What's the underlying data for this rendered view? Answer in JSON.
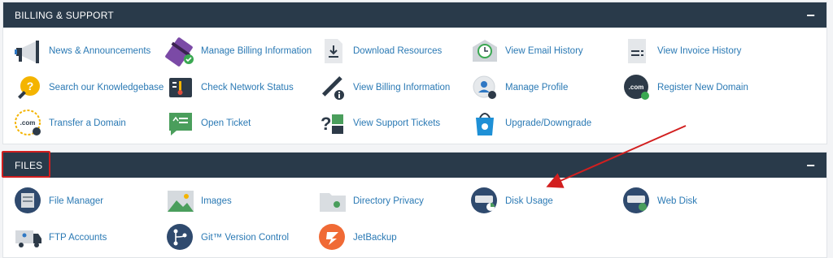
{
  "billing": {
    "title": "BILLING & SUPPORT",
    "collapse": "−",
    "items": [
      {
        "label": "News & Announcements",
        "icon": "megaphone-icon"
      },
      {
        "label": "Manage Billing Information",
        "icon": "credit-card-icon"
      },
      {
        "label": "Download Resources",
        "icon": "download-icon"
      },
      {
        "label": "View Email History",
        "icon": "email-history-icon"
      },
      {
        "label": "View Invoice History",
        "icon": "invoice-icon"
      },
      {
        "label": "Search our Knowledgebase",
        "icon": "knowledgebase-icon"
      },
      {
        "label": "Check Network Status",
        "icon": "network-status-icon"
      },
      {
        "label": "View Billing Information",
        "icon": "billing-info-icon"
      },
      {
        "label": "Manage Profile",
        "icon": "profile-icon"
      },
      {
        "label": "Register New Domain",
        "icon": "register-domain-icon"
      },
      {
        "label": "Transfer a Domain",
        "icon": "transfer-domain-icon"
      },
      {
        "label": "Open Ticket",
        "icon": "open-ticket-icon"
      },
      {
        "label": "View Support Tickets",
        "icon": "support-tickets-icon"
      },
      {
        "label": "Upgrade/Downgrade",
        "icon": "upgrade-icon"
      }
    ]
  },
  "files": {
    "title": "FILES",
    "collapse": "−",
    "items": [
      {
        "label": "File Manager",
        "icon": "file-manager-icon"
      },
      {
        "label": "Images",
        "icon": "images-icon"
      },
      {
        "label": "Directory Privacy",
        "icon": "directory-privacy-icon"
      },
      {
        "label": "Disk Usage",
        "icon": "disk-usage-icon"
      },
      {
        "label": "Web Disk",
        "icon": "web-disk-icon"
      },
      {
        "label": "FTP Accounts",
        "icon": "ftp-accounts-icon"
      },
      {
        "label": "Git™ Version Control",
        "icon": "git-icon"
      },
      {
        "label": "JetBackup",
        "icon": "jetbackup-icon"
      }
    ]
  },
  "colors": {
    "header_bg": "#293a4a",
    "link": "#2a79b4",
    "annotation_red": "#d21f1f"
  }
}
